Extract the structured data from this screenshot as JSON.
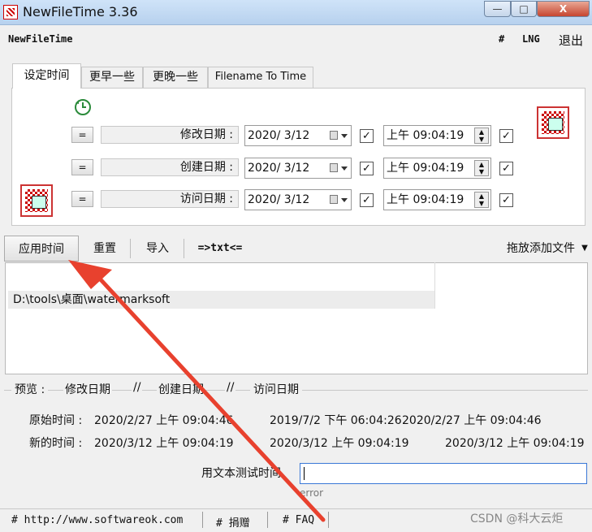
{
  "window": {
    "title": "NewFileTime 3.36",
    "min_glyph": "—",
    "max_glyph": "□",
    "close_glyph": "X"
  },
  "menu": {
    "app_name": "NewFileTime",
    "hash": "#",
    "lng": "LNG",
    "exit": "退出"
  },
  "tabs": [
    {
      "label": "设定时间",
      "active": true
    },
    {
      "label": "更早一些",
      "active": false
    },
    {
      "label": "更晚一些",
      "active": false
    },
    {
      "label": "Filename To Time",
      "active": false
    }
  ],
  "date_rows": [
    {
      "eq": "=",
      "label": "修改日期 :",
      "date": "2020/ 3/12",
      "time": "上午 09:04:19",
      "date_checked": true,
      "time_checked": true
    },
    {
      "eq": "=",
      "label": "创建日期 :",
      "date": "2020/ 3/12",
      "time": "上午 09:04:19",
      "date_checked": true,
      "time_checked": true
    },
    {
      "eq": "=",
      "label": "访问日期 :",
      "date": "2020/ 3/12",
      "time": "上午 09:04:19",
      "date_checked": true,
      "time_checked": true
    }
  ],
  "check_glyph": "✓",
  "toolbar": {
    "apply": "应用时间",
    "reset": "重置",
    "import": "导入",
    "txt": "=>txt<=",
    "drag_add": "拖放添加文件",
    "drag_arrow": "▼"
  },
  "file_list": {
    "rows": [
      "D:\\tools\\桌面\\watermarksoft"
    ]
  },
  "preview": {
    "title": "预览 :",
    "col1": "修改日期",
    "sep": "//",
    "col2": "创建日期",
    "col3": "访问日期",
    "orig_label": "原始时间 :",
    "orig_modified": "2020/2/27 上午 09:04:46",
    "orig_created": "2019/7/2 下午 06:04:26",
    "orig_accessed": "2020/2/27 上午 09:04:46",
    "new_label": "新的时间 :",
    "new_modified": "2020/3/12 上午 09:04:19",
    "new_created": "2020/3/12 上午 09:04:19",
    "new_accessed": "2020/3/12 上午 09:04:19"
  },
  "test": {
    "label": "用文本测试时间",
    "value": "",
    "error": "error"
  },
  "status": {
    "website": "# http://www.softwareok.com",
    "donate": "# 捐赠",
    "faq": "# FAQ"
  },
  "watermark": "CSDN @科大云炬",
  "colors": {
    "annotation_arrow": "#e8412e",
    "input_focus": "#3a78d6"
  }
}
